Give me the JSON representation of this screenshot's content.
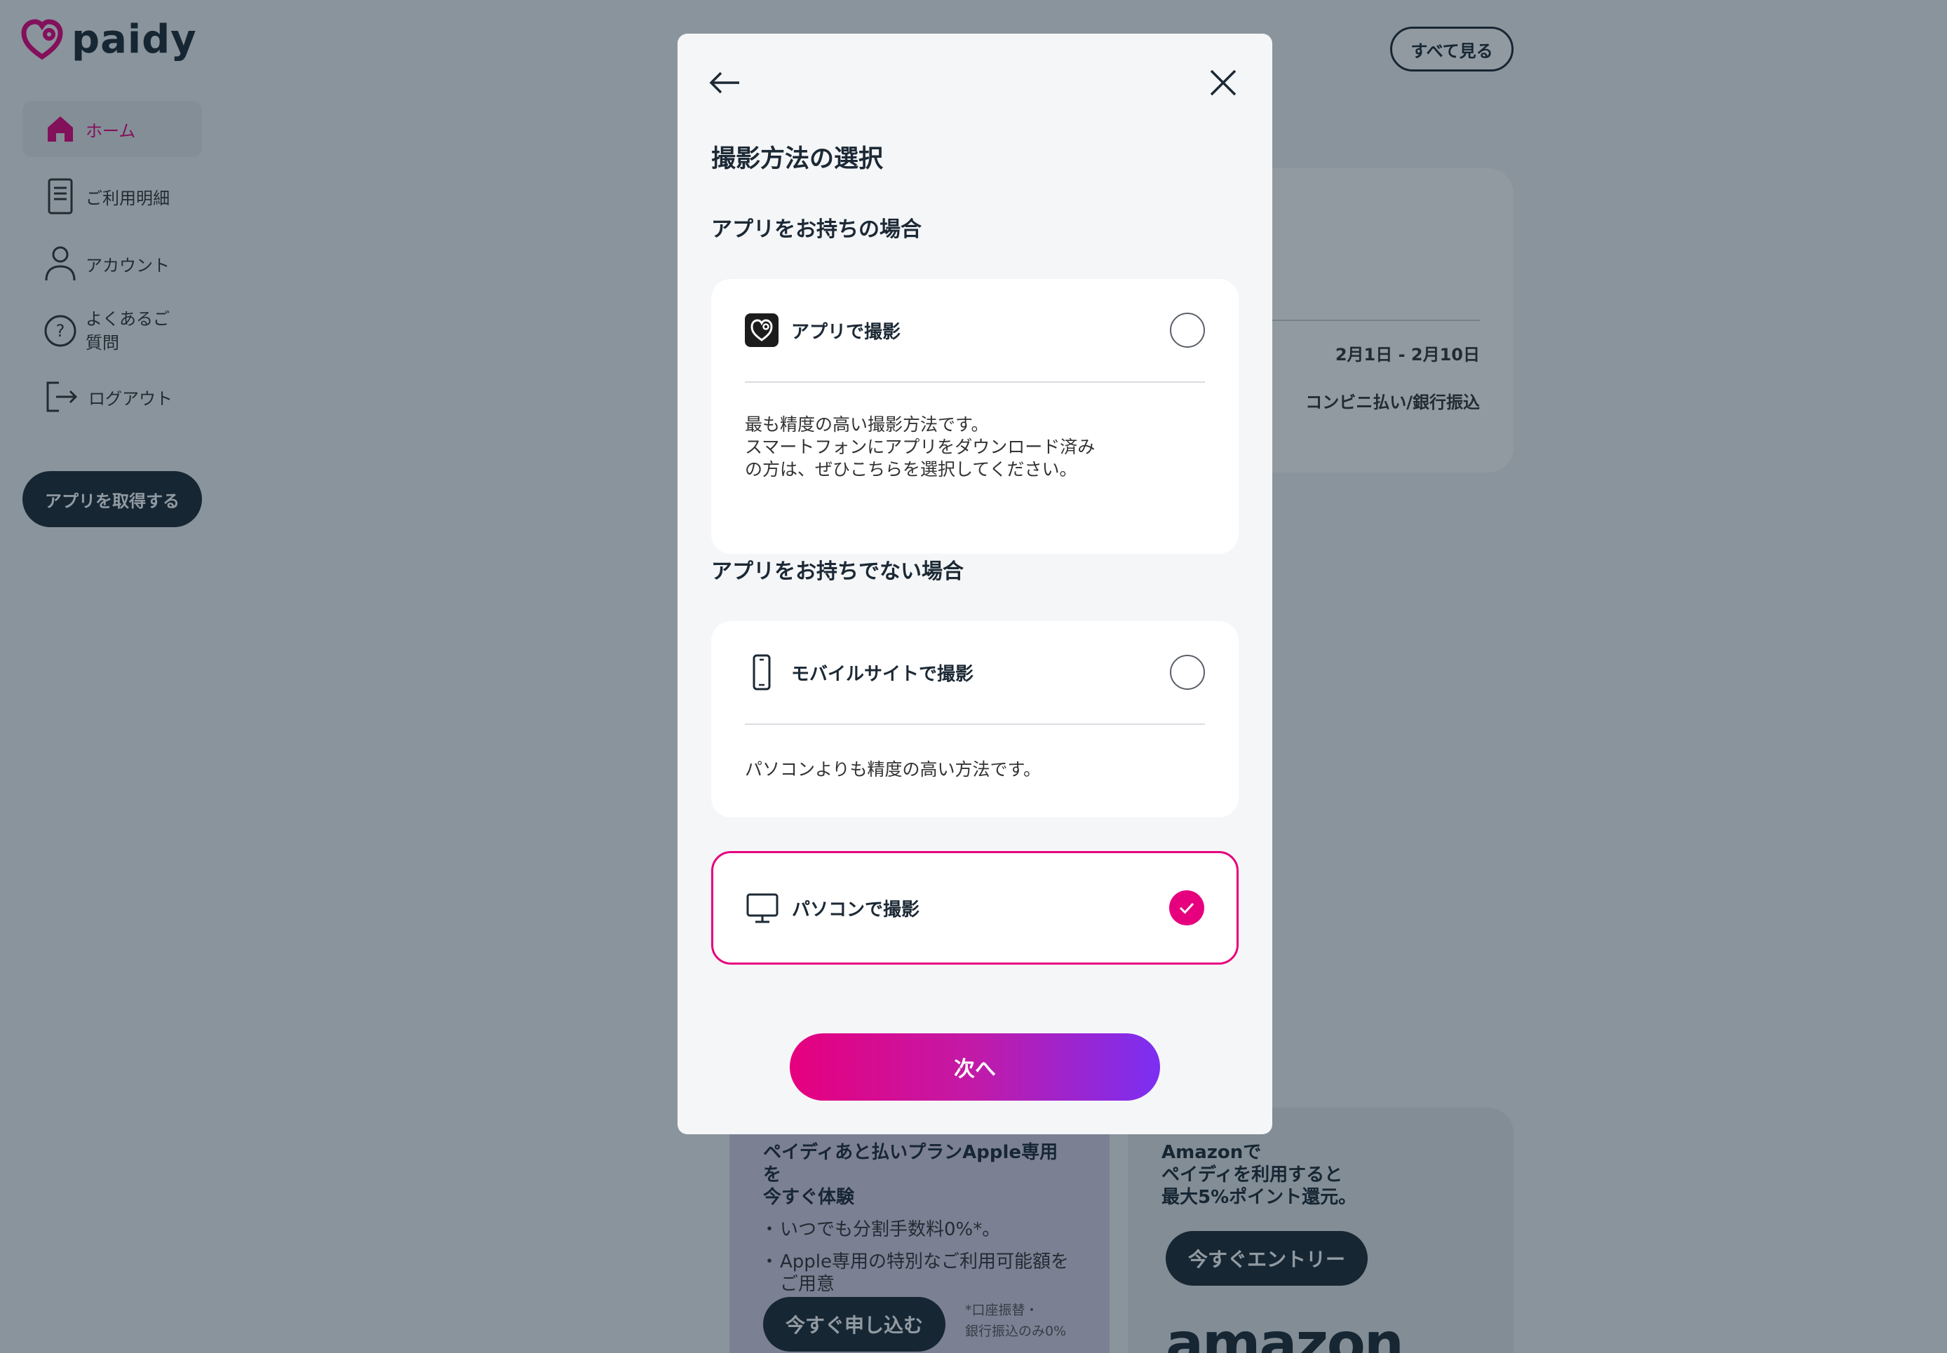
{
  "brand": {
    "name": "paidy",
    "accent": "#e6007e",
    "dark": "#1c2935"
  },
  "sidebar": {
    "items": [
      {
        "label": "ホーム",
        "icon": "home-icon",
        "active": true
      },
      {
        "label": "ご利用明細",
        "icon": "document-icon",
        "active": false
      },
      {
        "label": "アカウント",
        "icon": "user-icon",
        "active": false
      },
      {
        "label": "よくあるご\n質問",
        "icon": "question-icon",
        "active": false
      },
      {
        "label": "ログアウト",
        "icon": "logout-icon",
        "active": false
      }
    ],
    "get_app_label": "アプリを取得する"
  },
  "header": {
    "see_all_label": "すべて見る"
  },
  "billing": {
    "period": "2月1日 - 2月10日",
    "method": "コンビニ払い/銀行振込"
  },
  "promos": {
    "apple": {
      "title": "ペイディあと払いプランApple専用を\n今すぐ体験",
      "bullets": [
        "いつでも分割手数料0%*。",
        "Apple専用の特別なご利用可能額を\nご用意"
      ],
      "button_label": "今すぐ申し込む",
      "note": "*口座振替・\n銀行振込のみ0%"
    },
    "amazon": {
      "title": "Amazonで\nペイディを利用すると\n最大5%ポイント還元。",
      "button_label": "今すぐエントリー",
      "logo_text": "amazon"
    }
  },
  "modal": {
    "title": "撮影方法の選択",
    "section_with_app": "アプリをお持ちの場合",
    "section_without_app": "アプリをお持ちでない場合",
    "options": [
      {
        "label": "アプリで撮影",
        "icon": "paidy-app-icon",
        "selected": false,
        "description": "最も精度の高い撮影方法です。\nスマートフォンにアプリをダウンロード済み\nの方は、ぜひこちらを選択してください。"
      },
      {
        "label": "モバイルサイトで撮影",
        "icon": "smartphone-icon",
        "selected": false,
        "description": "パソコンよりも精度の高い方法です。"
      },
      {
        "label": "パソコンで撮影",
        "icon": "monitor-icon",
        "selected": true
      }
    ],
    "next_label": "次へ"
  }
}
